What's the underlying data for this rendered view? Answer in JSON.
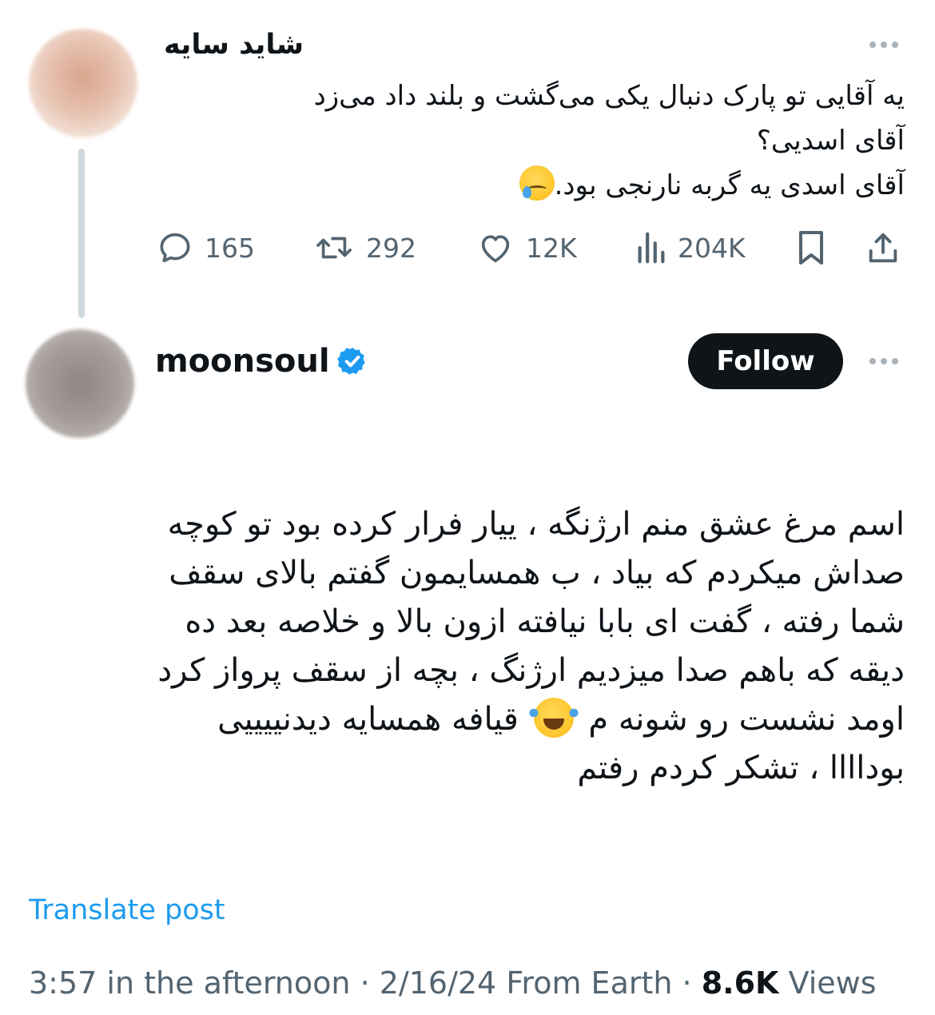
{
  "parent_tweet": {
    "author_name": "شاید سایه",
    "text_lines": [
      "یه آقایی تو پارک دنبال یکی می‌گشت و بلند داد می‌زد",
      "آقای اسدیی؟",
      "آقای اسدی یه گربه نارنجی بود."
    ],
    "emoji": "face-holding-back-tears",
    "stats": {
      "replies": "165",
      "reposts": "292",
      "likes": "12K",
      "views": "204K"
    }
  },
  "main_tweet": {
    "author_name": "moonsoul",
    "verified": true,
    "follow_label": "Follow",
    "text_lines": [
      "اسم مرغ عشق منم ارژنگه ، ییار فرار کرده بود تو کوچه",
      "صداش میکردم که بیاد ، ب همسایمون گفتم بالای سقف",
      "شما رفته ، گفت ای بابا نیافته ازون بالا و خلاصه بعد ده",
      "دیقه که باهم صدا میزدیم ارژنگ ، بچه از سقف پرواز کرد",
      "اومد نشست رو شونه م",
      "قیافه همسایه دیدنییییی",
      "بوداااا ، تشکر کردم رفتم"
    ],
    "emoji": "face-with-tears-of-joy",
    "translate_label": "Translate post",
    "time": "3:57 in the afternoon",
    "date": "2/16/24",
    "source": "From Earth",
    "views_count": "8.6K",
    "views_label": "Views"
  },
  "colors": {
    "text_primary": "#0f1419",
    "text_secondary": "#536471",
    "link": "#1d9bf0",
    "verified": "#1d9bf0",
    "thread_line": "#cfd9de"
  }
}
